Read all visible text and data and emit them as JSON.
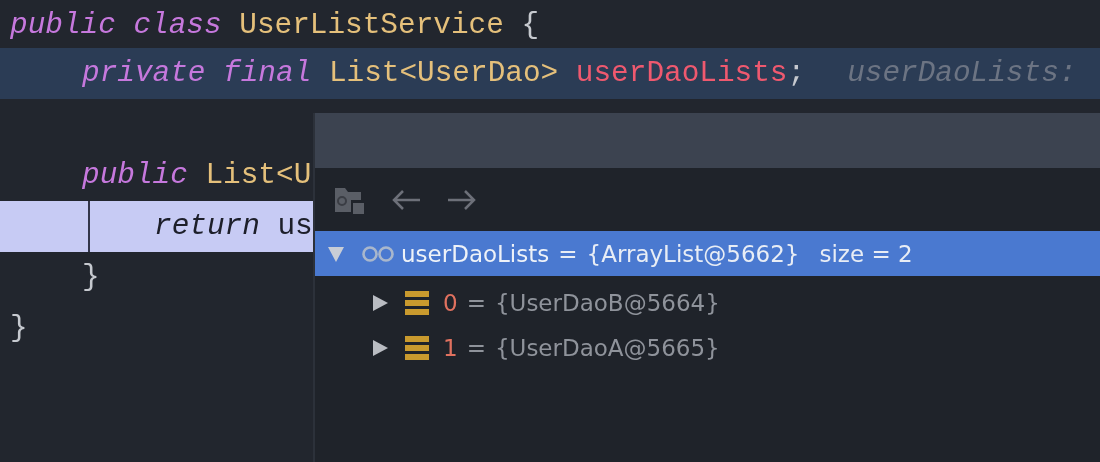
{
  "code_lines": [
    {
      "kind": "code",
      "caret_line": false,
      "execution_point": false,
      "tokens": [
        {
          "text": "public",
          "kind": "keyword"
        },
        {
          "text": "class",
          "kind": "keyword"
        },
        {
          "text": "UserListService",
          "kind": "type"
        },
        {
          "text": "{",
          "kind": "plain"
        }
      ],
      "children": [
        {
          "kind": "code",
          "caret_line": true,
          "execution_point": false,
          "tokens": [
            {
              "text": "private",
              "kind": "keyword"
            },
            {
              "text": "final",
              "kind": "keyword"
            },
            {
              "text": "List<UserDao>",
              "kind": "type"
            },
            {
              "text": "userDaoLists",
              "kind": "field"
            },
            {
              "text": ";",
              "kind": "plain",
              "join": true
            },
            {
              "text": "userDaoLists:",
              "kind": "hint"
            }
          ]
        },
        {
          "kind": "blank"
        },
        {
          "kind": "code",
          "caret_line": false,
          "execution_point": false,
          "tokens": [
            {
              "text": "public",
              "kind": "keyword"
            },
            {
              "text": "List<U",
              "kind": "type"
            }
          ],
          "children": [
            {
              "kind": "code",
              "caret_line": false,
              "execution_point": true,
              "tokens": [
                {
                  "text": "return",
                  "kind": "keyword"
                },
                {
                  "text": "us",
                  "kind": "plain"
                }
              ]
            }
          ]
        },
        {
          "kind": "code",
          "caret_line": false,
          "execution_point": false,
          "tokens": [
            {
              "text": "}",
              "kind": "plain"
            }
          ]
        }
      ]
    },
    {
      "kind": "code",
      "caret_line": false,
      "execution_point": false,
      "tokens": [
        {
          "text": "}",
          "kind": "plain"
        }
      ]
    }
  ],
  "debug_popup": {
    "toolbar": [
      {
        "kind": "folder"
      },
      {
        "kind": "back"
      },
      {
        "kind": "forward"
      }
    ],
    "tree": [
      {
        "kind": "watch",
        "name": "userDaoLists",
        "separator": "=",
        "value": "{ArrayList@5662}",
        "extra": "size = 2",
        "expanded": true,
        "selected": true,
        "children": [
          {
            "kind": "element",
            "name": "0",
            "separator": "=",
            "value": "{UserDaoB@5664}",
            "expanded": false,
            "selected": false
          },
          {
            "kind": "element",
            "name": "1",
            "separator": "=",
            "value": "{UserDaoA@5665}",
            "expanded": false,
            "selected": false
          }
        ]
      }
    ]
  }
}
